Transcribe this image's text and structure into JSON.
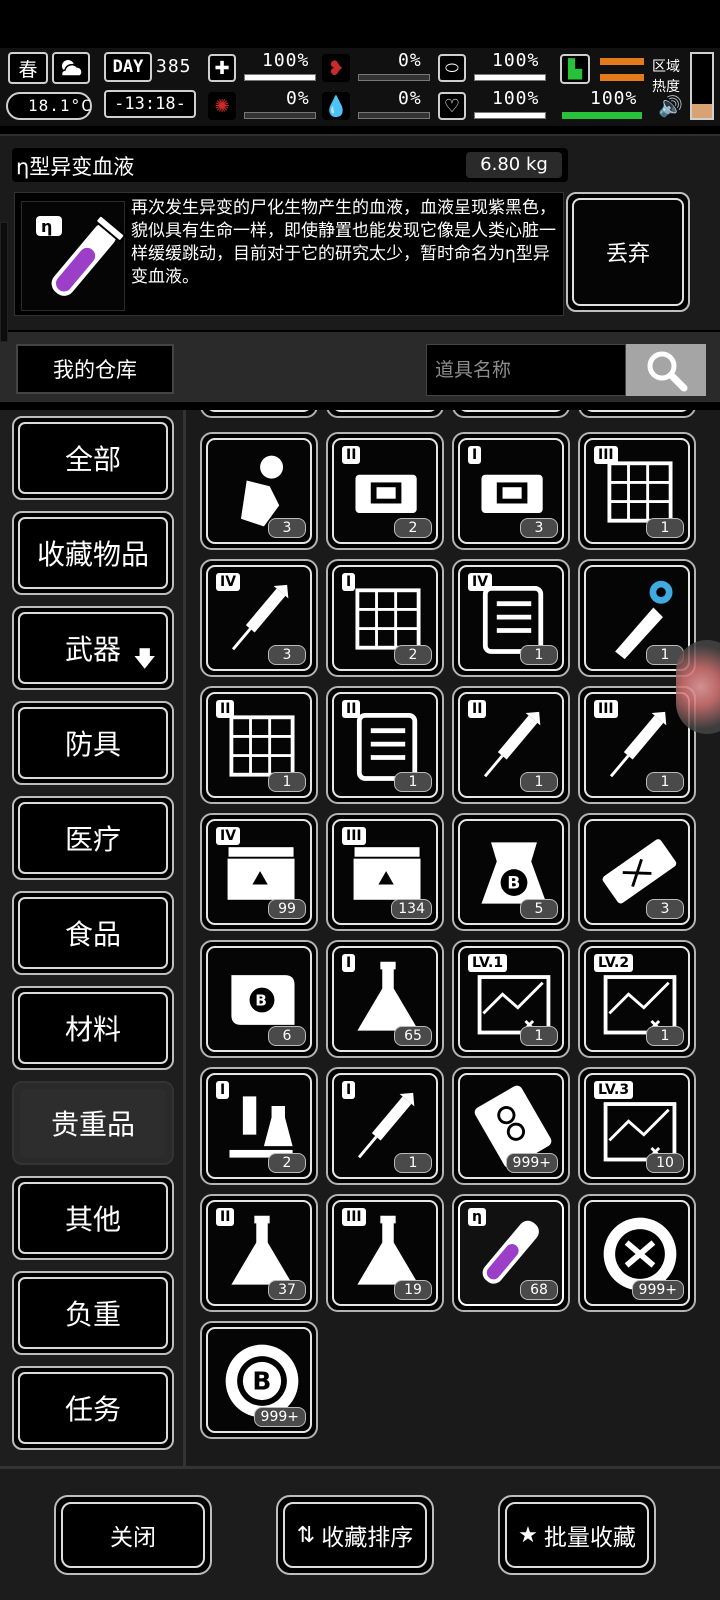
{
  "hud": {
    "season": "春",
    "temperature": "18.1°C",
    "day_label": "DAY",
    "day_number": "385",
    "clock": "-13:18-",
    "stats": [
      {
        "name": "health-kit",
        "value": "100%",
        "level": 1.0
      },
      {
        "name": "stomach",
        "value": "0%",
        "level": 0.0
      },
      {
        "name": "capsule",
        "value": "100%",
        "level": 1.0
      },
      {
        "name": "brain",
        "value": "0%",
        "level": 0.0
      },
      {
        "name": "blood",
        "value": "0%",
        "level": 0.0
      },
      {
        "name": "heart",
        "value": "100%",
        "level": 1.0
      }
    ],
    "stamina_value": "100%",
    "zone_heat_label_1": "区域",
    "zone_heat_label_2": "热度"
  },
  "item": {
    "name": "η型异变血液",
    "weight": "6.80 kg",
    "description": "再次发生异变的尸化生物产生的血液，血液呈现紫黑色，貌似具有生命一样，即使静置也能发现它像是人类心脏一样缓缓跳动，目前对于它的研究太少，暂时命名为η型异变血液。",
    "discard_label": "丢弃",
    "tier_label": "η"
  },
  "warehouse": {
    "label": "我的仓库",
    "search_placeholder": "道具名称"
  },
  "categories": [
    {
      "label": "全部",
      "arrow": ""
    },
    {
      "label": "收藏物品",
      "arrow": ""
    },
    {
      "label": "武器",
      "arrow": "🡇"
    },
    {
      "label": "防具",
      "arrow": ""
    },
    {
      "label": "医疗",
      "arrow": ""
    },
    {
      "label": "食品",
      "arrow": ""
    },
    {
      "label": "材料",
      "arrow": ""
    },
    {
      "label": "贵重品",
      "arrow": ""
    },
    {
      "label": "其他",
      "arrow": ""
    },
    {
      "label": "负重",
      "arrow": ""
    },
    {
      "label": "任务",
      "arrow": ""
    }
  ],
  "active_category": 7,
  "grid_items": [
    {
      "icon": "astronaut-icon",
      "tier": "",
      "count": "3"
    },
    {
      "icon": "chip-icon",
      "tier": "II",
      "count": "2"
    },
    {
      "icon": "chip-icon",
      "tier": "I",
      "count": "3"
    },
    {
      "icon": "circuit-board-icon",
      "tier": "III",
      "count": "1"
    },
    {
      "icon": "syringe-icon",
      "tier": "IV",
      "count": "3"
    },
    {
      "icon": "circuit-board-icon",
      "tier": "I",
      "count": "2"
    },
    {
      "icon": "engine-part-icon",
      "tier": "IV",
      "count": "1"
    },
    {
      "icon": "robot-arm-eye-icon",
      "tier": "",
      "count": "1"
    },
    {
      "icon": "circuit-board-icon",
      "tier": "II",
      "count": "1"
    },
    {
      "icon": "engine-part-icon",
      "tier": "II",
      "count": "1"
    },
    {
      "icon": "syringe-icon",
      "tier": "II",
      "count": "1"
    },
    {
      "icon": "syringe-icon",
      "tier": "III",
      "count": "1"
    },
    {
      "icon": "crate-icon",
      "tier": "IV",
      "count": "99"
    },
    {
      "icon": "crate-icon",
      "tier": "III",
      "count": "134"
    },
    {
      "icon": "coin-bag-icon",
      "tier": "",
      "count": "5"
    },
    {
      "icon": "ticket-icon",
      "tier": "",
      "count": "3"
    },
    {
      "icon": "scroll-icon",
      "tier": "",
      "count": "6"
    },
    {
      "icon": "flask-icon",
      "tier": "I",
      "count": "65"
    },
    {
      "icon": "map-icon",
      "tier": "LV.1",
      "count": "1"
    },
    {
      "icon": "map-icon",
      "tier": "LV.2",
      "count": "1"
    },
    {
      "icon": "lab-equipment-icon",
      "tier": "I",
      "count": "2"
    },
    {
      "icon": "syringe-icon",
      "tier": "I",
      "count": "1"
    },
    {
      "icon": "dna-card-icon",
      "tier": "",
      "count": "999+"
    },
    {
      "icon": "map-icon",
      "tier": "LV.3",
      "count": "10"
    },
    {
      "icon": "flask-icon",
      "tier": "II",
      "count": "37"
    },
    {
      "icon": "flask-icon",
      "tier": "III",
      "count": "19"
    },
    {
      "icon": "blood-vial-icon",
      "tier": "η",
      "count": "68"
    },
    {
      "icon": "tool-badge-icon",
      "tier": "",
      "count": "999+"
    },
    {
      "icon": "coin-icon",
      "tier": "",
      "count": "999+"
    }
  ],
  "selected_item": 26,
  "footer": {
    "close_label": "关闭",
    "sort_label": "收藏排序",
    "batch_label": "批量收藏"
  },
  "colors": {
    "stamina_green": "#27c23a",
    "hunger_orange": "#e37b1c",
    "vial_purple": "#9b3fc9"
  }
}
